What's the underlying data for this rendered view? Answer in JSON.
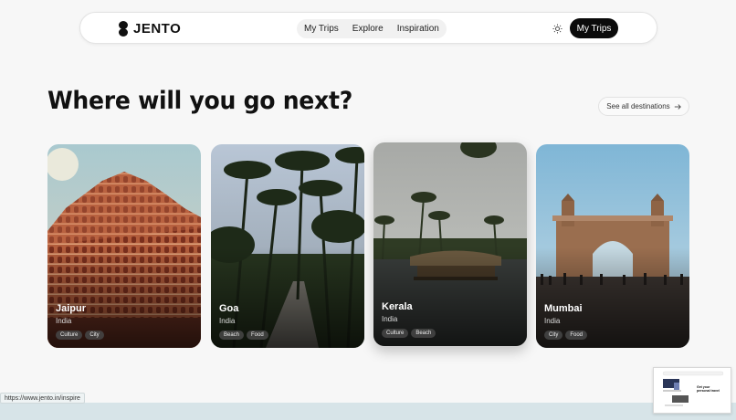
{
  "brand": {
    "name": "JENTO"
  },
  "nav": {
    "links": [
      "My Trips",
      "Explore",
      "Inspiration"
    ],
    "cta_label": "My Trips"
  },
  "hero": {
    "title": "Where will you go next?",
    "see_all_label": "See all destinations"
  },
  "destinations": [
    {
      "name": "Jaipur",
      "country": "India",
      "tags": [
        "Culture",
        "City"
      ]
    },
    {
      "name": "Goa",
      "country": "India",
      "tags": [
        "Beach",
        "Food"
      ]
    },
    {
      "name": "Kerala",
      "country": "India",
      "tags": [
        "Culture",
        "Beach"
      ]
    },
    {
      "name": "Mumbai",
      "country": "India",
      "tags": [
        "City",
        "Food"
      ]
    }
  ],
  "status_bar": {
    "url": "https://www.jento.in/inspire"
  },
  "preview": {
    "heading": "Get your personal travel"
  },
  "colors": {
    "accent": "#0b0b0b",
    "background": "#f7f7f7",
    "tag_bg": "#464646"
  },
  "icons": {
    "theme": "sun-icon",
    "see_all": "arrow-right-icon",
    "brand": "jento-logo-icon"
  }
}
